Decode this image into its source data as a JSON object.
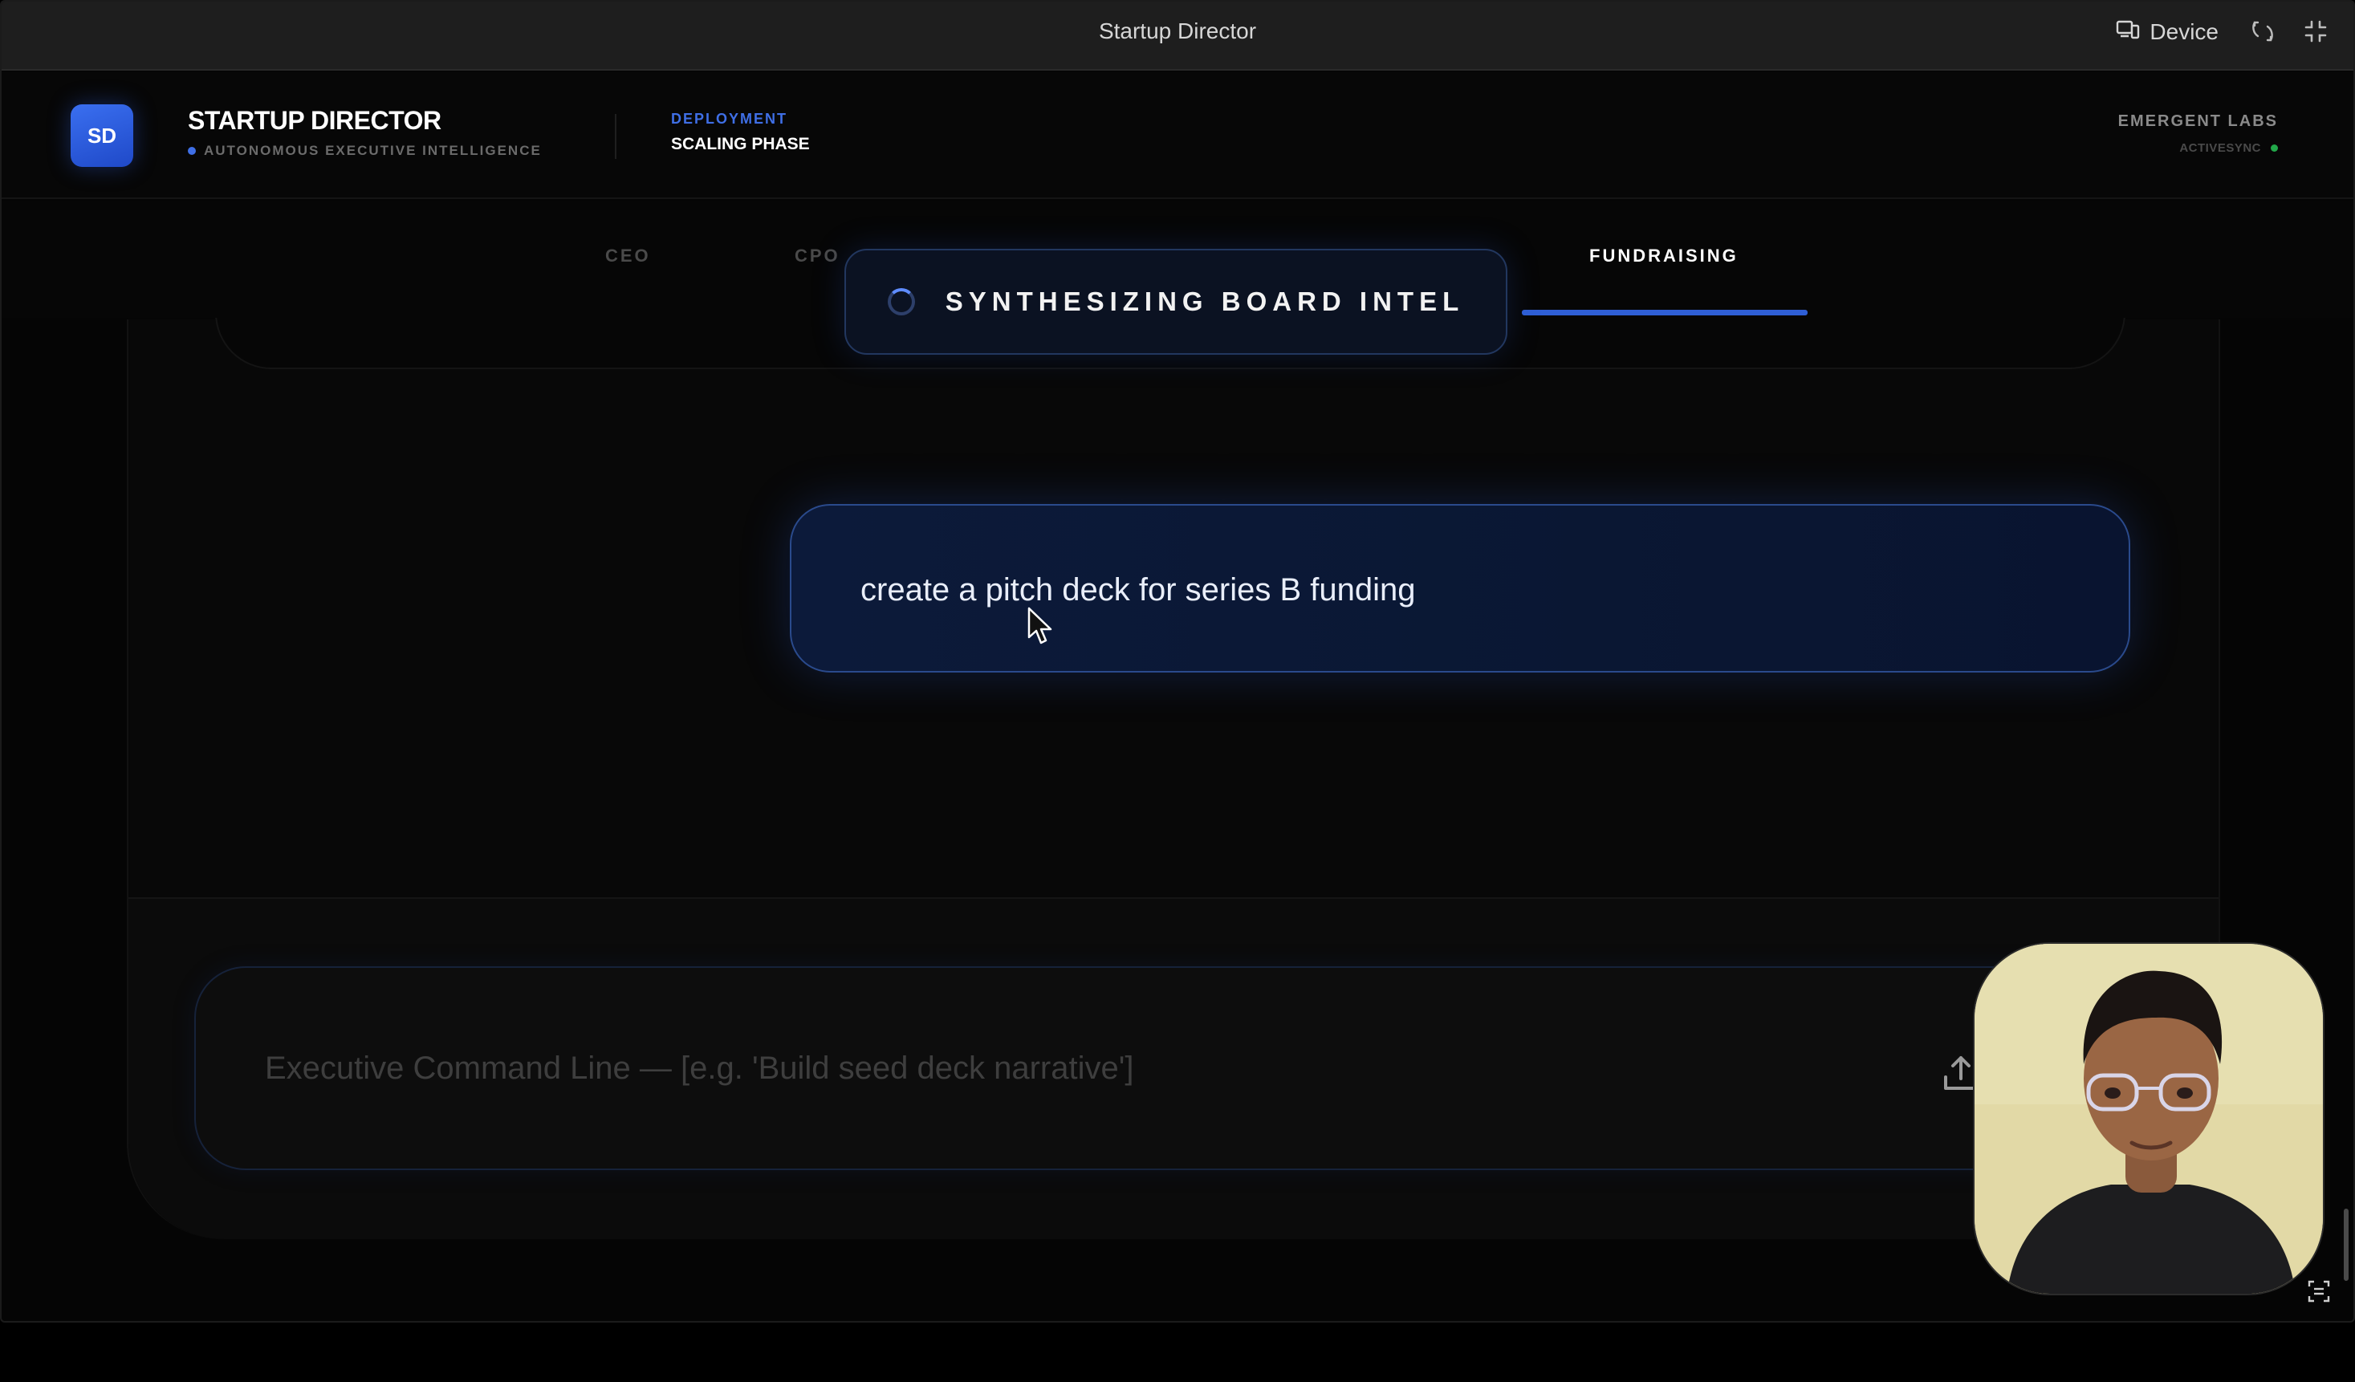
{
  "window": {
    "title": "Startup Director",
    "device_label": "Device",
    "device_icon": "device-icon",
    "rotate_icon": "rotate-icon",
    "fullscreen_icon": "fullscreen-icon"
  },
  "header": {
    "logo_text": "SD",
    "brand_name": "STARTUP DIRECTOR",
    "brand_subtitle": "AUTONOMOUS EXECUTIVE INTELLIGENCE",
    "deployment_label": "DEPLOYMENT",
    "deployment_value": "SCALING PHASE",
    "org_name": "EMERGENT LABS",
    "sync_status": "ACTIVESYNC"
  },
  "tabs": [
    {
      "label": "CEO",
      "active": false
    },
    {
      "label": "CPO",
      "active": false
    },
    {
      "label": "FUNDRAISING",
      "active": true
    }
  ],
  "status_overlay": {
    "text": "SYNTHESIZING BOARD INTEL",
    "icon": "spinner-icon"
  },
  "chat": {
    "user_message": "create a pitch deck for series B funding"
  },
  "command": {
    "placeholder": "Executive Command Line — [e.g. 'Build seed deck narrative']",
    "value": "",
    "upload_icon": "upload-icon"
  },
  "colors": {
    "accent": "#2f5fd6",
    "accent_text": "#3f6fe6",
    "bubble_border": "#2a4a8c",
    "status_online": "#22a84a",
    "background": "#050505"
  }
}
